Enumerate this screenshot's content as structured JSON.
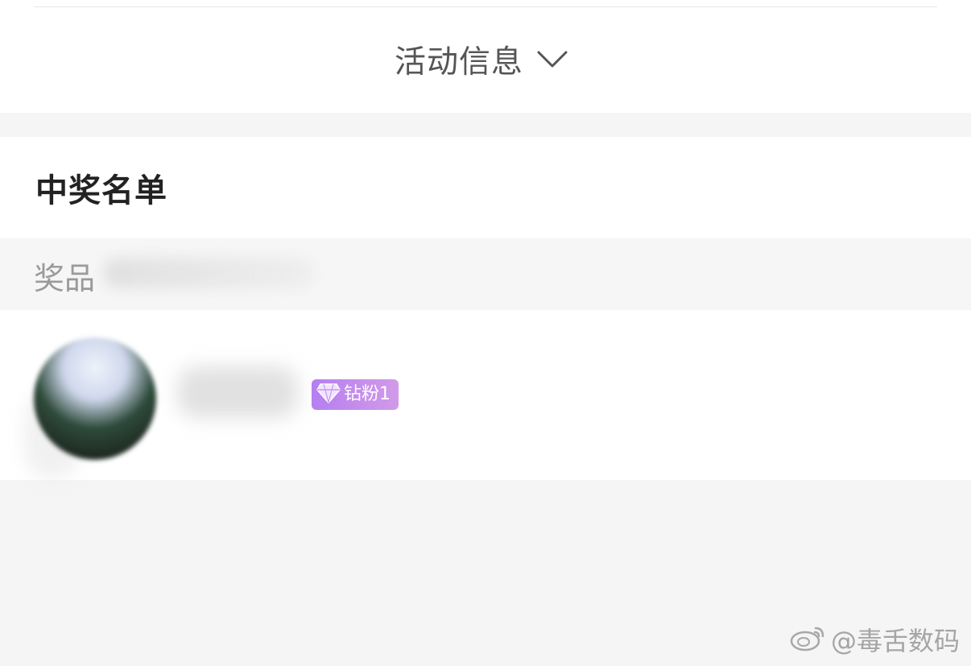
{
  "activity": {
    "toggle_label": "活动信息",
    "toggle_icon": "chevron-down-icon"
  },
  "winners": {
    "title": "中奖名单",
    "prize_label": "奖品",
    "items": [
      {
        "badge_icon": "diamond-icon",
        "badge_label": "钻粉1",
        "badge_colors": [
          "#b57ff0",
          "#d29ae8"
        ]
      }
    ]
  },
  "watermark": {
    "icon": "weibo-logo-icon",
    "text": "@毒舌数码"
  }
}
